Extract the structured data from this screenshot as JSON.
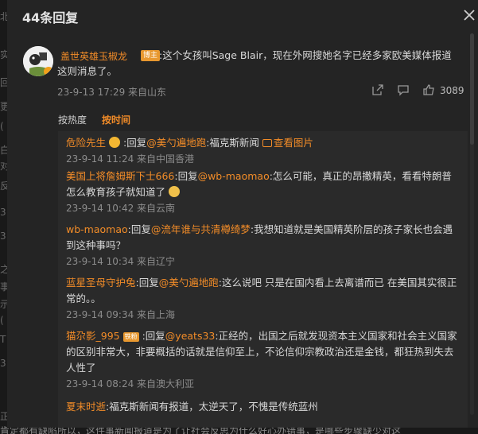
{
  "dialog": {
    "title": "44条回复"
  },
  "backdrop": {
    "edge_chars": [
      "实",
      "回",
      "更",
      "(",
      "白",
      "对",
      "反",
      "之",
      "事",
      "示",
      "(",
      "T",
      "正",
      "北",
      "3",
      "3",
      "3"
    ],
    "footer_text": "肯定都有缺陷所以，这件事新闻报道是为了让社会反思为什么好心办错事，是哪些步骤缺少对这"
  },
  "post": {
    "author": "盖世英雄玉椒龙",
    "badge": "博主",
    "text": ":这个女孩叫Sage Blair，现在外网搜她名字已经多家欧美媒体报道这则消息了。",
    "date": "23-9-13 17:29 来自山东",
    "like_count": "3089"
  },
  "sort": {
    "hot": "按热度",
    "time": "按时间"
  },
  "replies": [
    {
      "user": "危险先生",
      "reply_prefix": ":回复",
      "mention": "@美勺遍地跑",
      "text": ":福克斯新闻",
      "image_link": "查看图片",
      "date": "23-9-14 11:24 来自中国香港"
    },
    {
      "user": "美国上将詹姆斯下士666",
      "reply_prefix": ":回复",
      "mention": "@wb-maomao",
      "text": ":怎么可能，真正的昂撒精英，看看特朗普怎么教育孩子就知道了",
      "date": "23-9-14 10:42 来自云南"
    },
    {
      "user": "wb-maomao",
      "reply_prefix": ":回复",
      "mention": "@流年谁与共清樽绮梦",
      "text": ":我想知道就是美国精英阶层的孩子家长也会遇到这种事吗？",
      "date": "23-9-14 10:34 来自辽宁"
    },
    {
      "user": "蓝星圣母守护兔",
      "reply_prefix": ":回复",
      "mention": "@美勺遍地跑",
      "text": ":这么说吧 只是在国内看上去离谱而已 在美国其实很正常的。。",
      "date": "23-9-14 09:34 来自上海"
    },
    {
      "user": "猫尕影_995",
      "badge": "铁粉",
      "reply_prefix": ":回复",
      "mention": "@yeats33",
      "text": ":正经的，出国之后就发现资本主义国家和社会主义国家的区别非常大，非要概括的话就是信仰至上，不论信仰宗教政治还是金钱，都狂热到失去人性了",
      "date": "23-9-14 08:24 来自澳大利亚"
    },
    {
      "user": "夏末时逝",
      "text": ":福克斯新闻有报道，太逆天了，不愧是传统蓝州"
    }
  ]
}
